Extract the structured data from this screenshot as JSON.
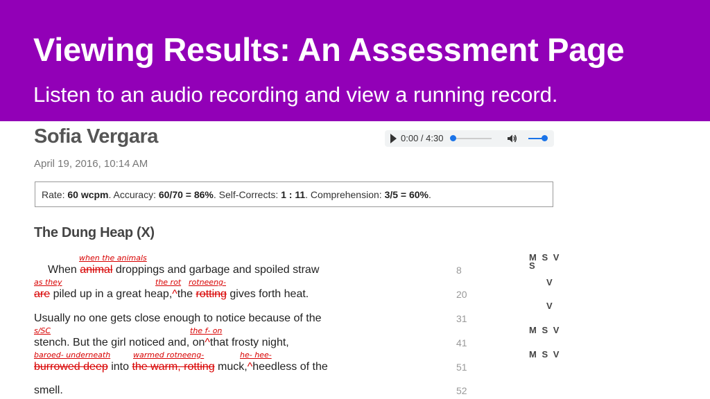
{
  "banner": {
    "title": "Viewing Results: An Assessment Page",
    "subtitle": "Listen to an audio recording and view a running record."
  },
  "student": {
    "name": "Sofia Vergara",
    "date": "April 19, 2016, 10:14 AM"
  },
  "player": {
    "time": "0:00 / 4:30",
    "progress": 0,
    "volume": 1.0,
    "icons": [
      "play-icon",
      "volume-icon"
    ]
  },
  "summary": {
    "rate_label": "Rate: ",
    "rate_value": "60 wcpm",
    "accuracy_label": ". Accuracy: ",
    "accuracy_value": "60/70 = 86%",
    "selfcorrect_label": ". Self-Corrects: ",
    "selfcorrect_value": "1 : 11",
    "comprehension_label": ". Comprehension: ",
    "comprehension_value": "3/5 = 60%",
    "end": "."
  },
  "passage": {
    "title": "The Dung Heap (X)",
    "lines": [
      {
        "parts": [
          "When ",
          "animal",
          " droppings and garbage and spoiled straw"
        ],
        "count": "8",
        "msv": "M S V",
        "msv2": "S"
      },
      {
        "parts": [
          "are",
          " piled up in a great heap,",
          "^",
          "the ",
          "rotting",
          " gives forth heat."
        ],
        "count": "20",
        "msv": "V"
      },
      {
        "parts": [
          "Usually no one gets close enough to notice because of the"
        ],
        "count": "31",
        "msv": "V"
      },
      {
        "parts": [
          "stench. But the girl noticed and, on",
          "^",
          "that frosty night,"
        ],
        "count": "41",
        "msv": "M S V"
      },
      {
        "parts": [
          "burrowed deep",
          " into ",
          "the warm, rotting",
          " muck,",
          "^",
          "heedless of the"
        ],
        "count": "51",
        "msv": "M S V"
      },
      {
        "parts": [
          "smell."
        ],
        "count": "52"
      }
    ],
    "annotations": {
      "a1": "when the animals",
      "a2": "as they",
      "a3": "the rot",
      "a4": "rotneeng-",
      "a5": "s/SC",
      "a6": "the f- on",
      "a7": "baroed- underneath",
      "a8": "warmed rotneeng-",
      "a9": "he- hee-"
    }
  }
}
